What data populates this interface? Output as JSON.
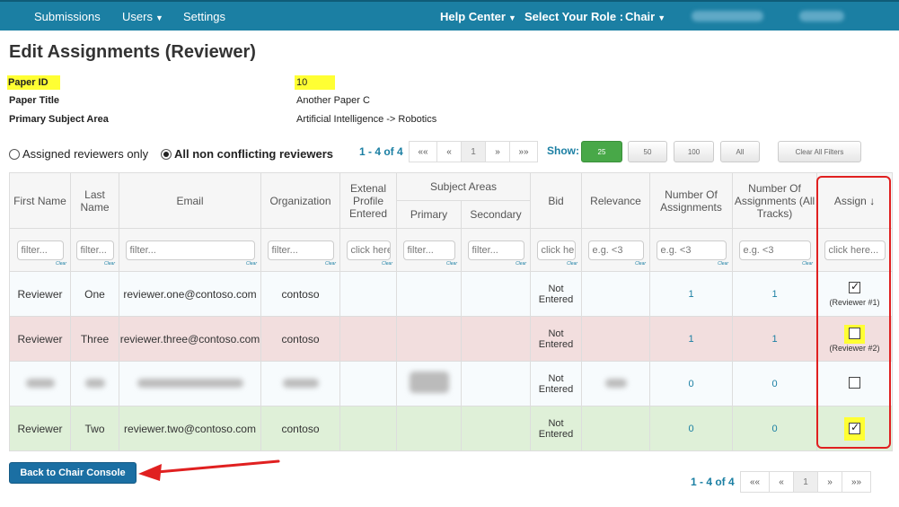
{
  "nav": {
    "submissions": "Submissions",
    "users": "Users",
    "settings": "Settings",
    "help_center": "Help Center",
    "role_label": "Select Your Role :",
    "role_value": "Chair"
  },
  "page_title": "Edit Assignments (Reviewer)",
  "paper": {
    "id_label": "Paper ID",
    "id_value": "10",
    "title_label": "Paper Title",
    "title_value": "Another Paper C",
    "subject_label": "Primary Subject Area",
    "subject_value": "Artificial Intelligence -> Robotics"
  },
  "filters": {
    "assigned_only": "Assigned reviewers only",
    "non_conflicting": "All non conflicting reviewers",
    "selected": "non_conflicting"
  },
  "pagination": {
    "count": "1 - 4 of 4",
    "first": "««",
    "prev": "«",
    "page": "1",
    "next": "»",
    "last": "»»"
  },
  "show": {
    "label": "Show:",
    "sizes": [
      "25",
      "50",
      "100",
      "All"
    ],
    "active": "25",
    "clear_filters": "Clear All Filters"
  },
  "table": {
    "headers": {
      "first_name": "First Name",
      "last_name": "Last Name",
      "email": "Email",
      "organization": "Organization",
      "external_profile": "Extenal Profile Entered",
      "subject_areas": "Subject Areas",
      "primary": "Primary",
      "secondary": "Secondary",
      "bid": "Bid",
      "relevance": "Relevance",
      "num_assignments": "Number Of Assignments",
      "num_assignments_all": "Number Of Assignments (All Tracks)",
      "assign": "Assign",
      "sort_icon": "↓"
    },
    "filter_placeholders": {
      "text": "filter...",
      "click": "click here...",
      "numeric": "e.g. <3",
      "clear": "Clear"
    },
    "rows": [
      {
        "first": "Reviewer",
        "last": "One",
        "email": "reviewer.one@contoso.com",
        "org": "contoso",
        "bid": "Not Entered",
        "num": "1",
        "num_all": "1",
        "assigned": true,
        "label": "(Reviewer #1)"
      },
      {
        "first": "Reviewer",
        "last": "Three",
        "email": "reviewer.three@contoso.com",
        "org": "contoso",
        "bid": "Not Entered",
        "num": "1",
        "num_all": "1",
        "assigned": false,
        "label": "(Reviewer #2)"
      },
      {
        "first": "",
        "last": "",
        "email": "",
        "org": "",
        "bid": "Not Entered",
        "num": "0",
        "num_all": "0",
        "assigned": false,
        "label": ""
      },
      {
        "first": "Reviewer",
        "last": "Two",
        "email": "reviewer.two@contoso.com",
        "org": "contoso",
        "bid": "Not Entered",
        "num": "0",
        "num_all": "0",
        "assigned": true,
        "label": ""
      }
    ]
  },
  "back_button": "Back to Chair Console",
  "colors": {
    "navbar": "#1b7fa3",
    "accent": "#1b7fa3",
    "row_red": "#f2dede",
    "row_green": "#dff0d8",
    "highlight": "#ffff33",
    "annotation_red": "#e02020"
  }
}
